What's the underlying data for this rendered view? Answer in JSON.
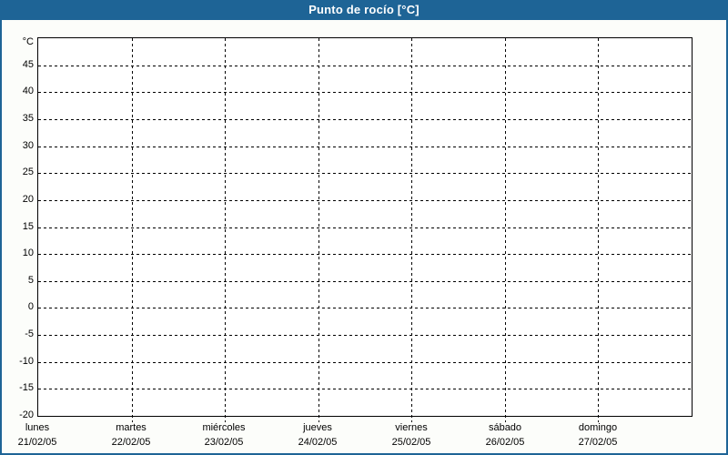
{
  "title": "Punto de rocío [°C]",
  "colors": {
    "titlebar_bg": "#1e6496",
    "title_text": "#ffffff",
    "window_border": "#1e6496",
    "page_bg": "#fcfdfa",
    "plot_bg": "#ffffff",
    "grid_line": "#000000",
    "label_text": "#000000"
  },
  "chart_data": {
    "type": "line",
    "title": "Punto de rocío [°C]",
    "ylabel": "°C",
    "ylim": [
      -20,
      50
    ],
    "ytick_step": 5,
    "yticks": [
      45,
      40,
      35,
      30,
      25,
      20,
      15,
      10,
      5,
      0,
      -5,
      -10,
      -15,
      -20
    ],
    "x_categories": [
      {
        "day": "lunes",
        "date": "21/02/05"
      },
      {
        "day": "martes",
        "date": "22/02/05"
      },
      {
        "day": "miércoles",
        "date": "23/02/05"
      },
      {
        "day": "jueves",
        "date": "24/02/05"
      },
      {
        "day": "viernes",
        "date": "25/02/05"
      },
      {
        "day": "sábado",
        "date": "26/02/05"
      },
      {
        "day": "domingo",
        "date": "27/02/05"
      }
    ],
    "series": [],
    "grid": "dashed",
    "legend_position": "none"
  }
}
